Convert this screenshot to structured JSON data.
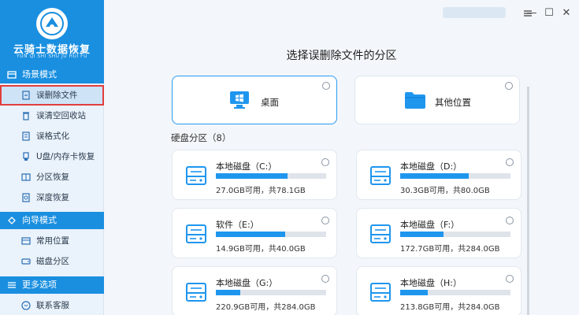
{
  "app": {
    "title": "云骑士数据恢复",
    "subtitle": "YUN QI SHI SHU JU HUI FU"
  },
  "sidebar": {
    "sections": [
      {
        "title": "场景模式",
        "items": [
          {
            "label": "误删除文件",
            "icon": "file-delete-icon"
          },
          {
            "label": "误清空回收站",
            "icon": "recycle-bin-icon"
          },
          {
            "label": "误格式化",
            "icon": "format-icon"
          },
          {
            "label": "U盘/内存卡恢复",
            "icon": "usb-icon"
          },
          {
            "label": "分区恢复",
            "icon": "partition-icon"
          },
          {
            "label": "深度恢复",
            "icon": "deep-scan-icon"
          }
        ]
      },
      {
        "title": "向导模式",
        "items": [
          {
            "label": "常用位置",
            "icon": "common-location-icon"
          },
          {
            "label": "磁盘分区",
            "icon": "disk-partition-icon"
          }
        ]
      },
      {
        "title": "更多选项",
        "items": [
          {
            "label": "联系客服",
            "icon": "customer-service-icon"
          }
        ]
      }
    ]
  },
  "window": {
    "minimize": "—",
    "maximize": "☐",
    "close": "✕"
  },
  "main": {
    "title": "选择误删除文件的分区",
    "locations": [
      {
        "label": "桌面",
        "icon": "desktop-icon",
        "selected": true
      },
      {
        "label": "其他位置",
        "icon": "folder-icon",
        "selected": false
      }
    ],
    "group_title": "硬盘分区（8）",
    "drives": [
      {
        "name": "本地磁盘（C:）",
        "size": "27.0GB可用，共78.1GB",
        "used_fraction": 0.65
      },
      {
        "name": "本地磁盘（D:）",
        "size": "30.3GB可用，共80.0GB",
        "used_fraction": 0.62
      },
      {
        "name": "软件（E:）",
        "size": "14.9GB可用，共40.0GB",
        "used_fraction": 0.63
      },
      {
        "name": "本地磁盘（F:）",
        "size": "172.7GB可用，共284.0GB",
        "used_fraction": 0.39
      },
      {
        "name": "本地磁盘（G:）",
        "size": "220.9GB可用，共284.0GB",
        "used_fraction": 0.22
      },
      {
        "name": "本地磁盘（H:）",
        "size": "213.8GB可用，共284.0GB",
        "used_fraction": 0.25
      }
    ]
  },
  "colors": {
    "accent": "#1a8fe0",
    "bar": "#1f96ee",
    "highlight": "#e23d3d"
  }
}
